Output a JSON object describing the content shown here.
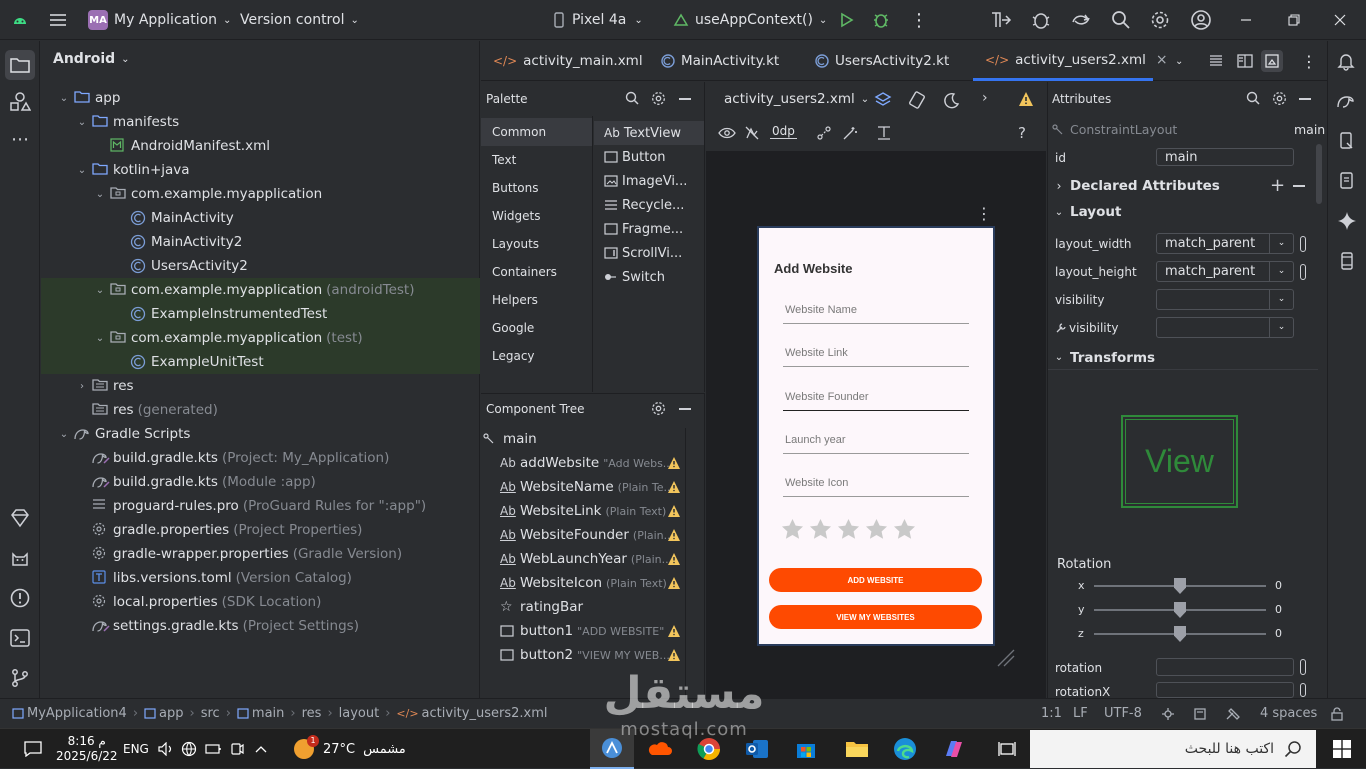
{
  "titlebar": {
    "app_badge": "MA",
    "project": "My Application",
    "vcs": "Version control",
    "device": "Pixel 4a",
    "run_config": "useAppContext()"
  },
  "project_pane": {
    "view_mode": "Android",
    "tree": [
      {
        "label": "app",
        "sub": ""
      },
      {
        "label": "manifests",
        "sub": ""
      },
      {
        "label": "AndroidManifest.xml",
        "sub": ""
      },
      {
        "label": "kotlin+java",
        "sub": ""
      },
      {
        "label": "com.example.myapplication",
        "sub": ""
      },
      {
        "label": "MainActivity",
        "sub": ""
      },
      {
        "label": "MainActivity2",
        "sub": ""
      },
      {
        "label": "UsersActivity2",
        "sub": ""
      },
      {
        "label": "com.example.myapplication",
        "sub": "(androidTest)"
      },
      {
        "label": "ExampleInstrumentedTest",
        "sub": ""
      },
      {
        "label": "com.example.myapplication",
        "sub": "(test)"
      },
      {
        "label": "ExampleUnitTest",
        "sub": ""
      },
      {
        "label": "res",
        "sub": ""
      },
      {
        "label": "res",
        "sub": "(generated)"
      },
      {
        "label": "Gradle Scripts",
        "sub": ""
      },
      {
        "label": "build.gradle.kts",
        "sub": "(Project: My_Application)"
      },
      {
        "label": "build.gradle.kts",
        "sub": "(Module :app)"
      },
      {
        "label": "proguard-rules.pro",
        "sub": "(ProGuard Rules for \":app\")"
      },
      {
        "label": "gradle.properties",
        "sub": "(Project Properties)"
      },
      {
        "label": "gradle-wrapper.properties",
        "sub": "(Gradle Version)"
      },
      {
        "label": "libs.versions.toml",
        "sub": "(Version Catalog)"
      },
      {
        "label": "local.properties",
        "sub": "(SDK Location)"
      },
      {
        "label": "settings.gradle.kts",
        "sub": "(Project Settings)"
      }
    ]
  },
  "editor_tabs": [
    "activity_main.xml",
    "MainActivity.kt",
    "UsersActivity2.kt",
    "activity_users2.xml"
  ],
  "palette": {
    "title": "Palette",
    "categories": [
      "Common",
      "Text",
      "Buttons",
      "Widgets",
      "Layouts",
      "Containers",
      "Helpers",
      "Google",
      "Legacy"
    ],
    "items": [
      "TextView",
      "Button",
      "ImageVi...",
      "Recycle...",
      "Fragme...",
      "ScrollVi...",
      "Switch"
    ],
    "textview_prefix": "Ab"
  },
  "component_tree": {
    "title": "Component Tree",
    "rows": [
      {
        "label": "main",
        "sub": ""
      },
      {
        "label": "addWebsite",
        "sub": "\"Add Webs..."
      },
      {
        "label": "WebsiteName",
        "sub": "(Plain Te..."
      },
      {
        "label": "WebsiteLink",
        "sub": "(Plain Text)"
      },
      {
        "label": "WebsiteFounder",
        "sub": "(Plain..."
      },
      {
        "label": "WebLaunchYear",
        "sub": "(Plain..."
      },
      {
        "label": "WebsiteIcon",
        "sub": "(Plain Text)"
      },
      {
        "label": "ratingBar",
        "sub": ""
      },
      {
        "label": "button1",
        "sub": "\"ADD WEBSITE\""
      },
      {
        "label": "button2",
        "sub": "\"VIEW MY WEB..."
      }
    ]
  },
  "design_toolbar": {
    "file": "activity_users2.xml",
    "margin": "0dp"
  },
  "phone_preview": {
    "heading": "Add Website",
    "fields": [
      "Website Name",
      "Website Link",
      "Website Founder",
      "Launch year",
      "Website Icon"
    ],
    "rating_stars_total": 5,
    "button1": "ADD WEBSITE",
    "button2": "VIEW MY WEBSITES",
    "accent_color": "#fe4a01"
  },
  "attributes": {
    "title": "Attributes",
    "class": "ConstraintLayout",
    "id_value": "main",
    "id_label": "id",
    "id_field": "main",
    "declared": "Declared Attributes",
    "layout_section": "Layout",
    "layout_width_label": "layout_width",
    "layout_width": "match_parent",
    "layout_height_label": "layout_height",
    "layout_height": "match_parent",
    "visibility_label": "visibility",
    "visibility_tools_label": "visibility",
    "transforms": "Transforms",
    "view_preview": "View",
    "rotation_title": "Rotation",
    "rot_x_label": "x",
    "rot_y_label": "y",
    "rot_z_label": "z",
    "rot_x": "0",
    "rot_y": "0",
    "rot_z": "0",
    "rotation_label": "rotation",
    "rotationx_label": "rotationX"
  },
  "statusbar": {
    "breadcrumbs": [
      "MyApplication4",
      "app",
      "src",
      "main",
      "res",
      "layout",
      "activity_users2.xml"
    ],
    "position": "1:1",
    "line_sep": "LF",
    "encoding": "UTF-8",
    "indent": "4 spaces"
  },
  "taskbar": {
    "time": "8:16 م",
    "date": "2025/6/22",
    "lang": "ENG",
    "weather_temp": "27°C",
    "weather_text": "مشمس",
    "weather_badge": "1",
    "search_placeholder": "اكتب هنا للبحث"
  },
  "watermark": {
    "text": "مستقل",
    "sub": "mostaql.com"
  }
}
